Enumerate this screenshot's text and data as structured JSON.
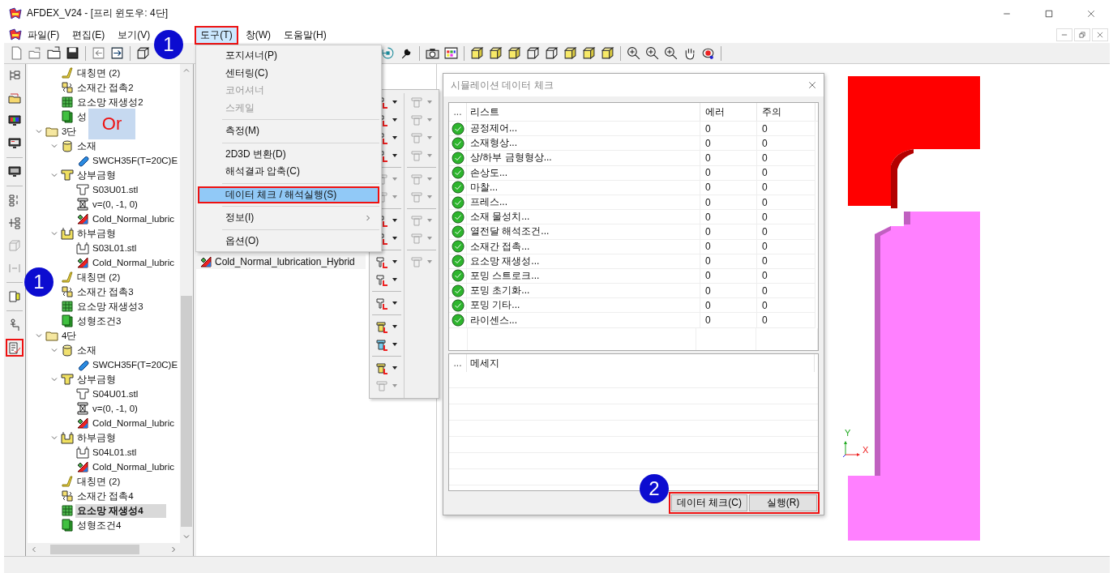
{
  "window": {
    "title": "AFDEX_V24 - [프리 윈도우: 4단]"
  },
  "menu_bar": [
    {
      "label": "파일(F)",
      "selected": false,
      "outlined": false
    },
    {
      "label": "편집(E)",
      "selected": false,
      "outlined": false
    },
    {
      "label": "보기(V)",
      "selected": false,
      "outlined": false
    },
    {
      "label": "도구(T)",
      "selected": true,
      "outlined": true
    },
    {
      "label": "창(W)",
      "selected": false,
      "outlined": false
    },
    {
      "label": "도움말(H)",
      "selected": false,
      "outlined": false
    }
  ],
  "left_toolbar": [
    {
      "outlined": false
    },
    {
      "outlined": false
    },
    {
      "outlined": false
    },
    {
      "outlined": false
    },
    {
      "outlined": false
    },
    {
      "outlined": false
    },
    {
      "outlined": false
    },
    {
      "outlined": false
    },
    {
      "outlined": false
    },
    {
      "outlined": false
    },
    {
      "outlined": false
    },
    {
      "outlined": true
    }
  ],
  "tree": {
    "continued_items": [
      {
        "label": "대칭면 (2)",
        "kind": "symmetry",
        "selected": false
      },
      {
        "label": "소재간 접촉2",
        "kind": "contact",
        "selected": false
      },
      {
        "label": "요소망 재생성2",
        "kind": "remesh",
        "selected": false
      },
      {
        "label": "성",
        "kind": "condition",
        "selected": false
      }
    ],
    "items": [
      {
        "label": "3단",
        "kind": "folder",
        "selected": false,
        "expanded": true,
        "children": [
          {
            "label": "소재",
            "kind": "material",
            "selected": false,
            "expanded": true,
            "children": [
              {
                "label": "SWCH35F(T=20C)E",
                "kind": "billet",
                "selected": false
              }
            ]
          },
          {
            "label": "상부금형",
            "kind": "upper-die",
            "selected": false,
            "expanded": true,
            "children": [
              {
                "label": "S03U01.stl",
                "kind": "die-file",
                "selected": false
              },
              {
                "label": "v=(0, -1, 0)",
                "kind": "velocity",
                "selected": false
              },
              {
                "label": "Cold_Normal_lubric",
                "kind": "lubricant",
                "selected": false
              }
            ]
          },
          {
            "label": "하부금형",
            "kind": "lower-die",
            "selected": false,
            "expanded": true,
            "children": [
              {
                "label": "S03L01.stl",
                "kind": "lower-file",
                "selected": false
              },
              {
                "label": "Cold_Normal_lubric",
                "kind": "lubricant",
                "selected": false
              }
            ]
          },
          {
            "label": "대칭면 (2)",
            "kind": "symmetry",
            "selected": false
          },
          {
            "label": "소재간 접촉3",
            "kind": "contact",
            "selected": false
          },
          {
            "label": "요소망 재생성3",
            "kind": "remesh",
            "selected": false
          },
          {
            "label": "성형조건3",
            "kind": "condition",
            "selected": false
          }
        ]
      },
      {
        "label": "4단",
        "kind": "folder",
        "selected": false,
        "expanded": true,
        "children": [
          {
            "label": "소재",
            "kind": "material",
            "selected": false,
            "expanded": true,
            "children": [
              {
                "label": "SWCH35F(T=20C)E",
                "kind": "billet",
                "selected": false
              }
            ]
          },
          {
            "label": "상부금형",
            "kind": "upper-die",
            "selected": false,
            "expanded": true,
            "children": [
              {
                "label": "S04U01.stl",
                "kind": "die-file",
                "selected": false
              },
              {
                "label": "v=(0, -1, 0)",
                "kind": "velocity",
                "selected": false
              },
              {
                "label": "Cold_Normal_lubric",
                "kind": "lubricant",
                "selected": false
              }
            ]
          },
          {
            "label": "하부금형",
            "kind": "lower-die",
            "selected": false,
            "expanded": true,
            "children": [
              {
                "label": "S04L01.stl",
                "kind": "lower-file",
                "selected": false
              },
              {
                "label": "Cold_Normal_lubric",
                "kind": "lubricant",
                "selected": false
              }
            ]
          },
          {
            "label": "대칭면 (2)",
            "kind": "symmetry",
            "selected": false
          },
          {
            "label": "소재간 접촉4",
            "kind": "contact",
            "selected": false
          },
          {
            "label": "요소망 재생성4",
            "kind": "remesh",
            "selected": true
          },
          {
            "label": "성형조건4",
            "kind": "condition",
            "selected": false
          }
        ]
      }
    ]
  },
  "side_panel": {
    "items": [
      {
        "label": "Cold_Normal_lubrication_Hybrid",
        "kind": "lubricant"
      }
    ]
  },
  "tools_menu": {
    "entries": [
      {
        "kind": "item",
        "label": "포지셔너(P)",
        "disabled": false,
        "selected": false,
        "outlined": false,
        "submenu": false
      },
      {
        "kind": "item",
        "label": "센터링(C)",
        "disabled": false,
        "selected": false,
        "outlined": false,
        "submenu": false
      },
      {
        "kind": "item",
        "label": "코어셔너",
        "disabled": true,
        "selected": false,
        "outlined": false,
        "submenu": false
      },
      {
        "kind": "item",
        "label": "스케일",
        "disabled": true,
        "selected": false,
        "outlined": false,
        "submenu": false
      },
      {
        "kind": "separator"
      },
      {
        "kind": "item",
        "label": "측정(M)",
        "disabled": false,
        "selected": false,
        "outlined": false,
        "submenu": false
      },
      {
        "kind": "separator"
      },
      {
        "kind": "item",
        "label": "2D3D 변환(D)",
        "disabled": false,
        "selected": false,
        "outlined": false,
        "submenu": false
      },
      {
        "kind": "item",
        "label": "해석결과 압축(C)",
        "disabled": false,
        "selected": false,
        "outlined": false,
        "submenu": false
      },
      {
        "kind": "separator"
      },
      {
        "kind": "item",
        "label": "데이터 체크 / 해석실행(S)",
        "disabled": false,
        "selected": true,
        "outlined": true,
        "submenu": false
      },
      {
        "kind": "separator"
      },
      {
        "kind": "item",
        "label": "정보(I)",
        "disabled": false,
        "selected": false,
        "outlined": false,
        "submenu": true
      },
      {
        "kind": "separator"
      },
      {
        "kind": "item",
        "label": "옵션(O)",
        "disabled": false,
        "selected": false,
        "outlined": false,
        "submenu": false
      }
    ]
  },
  "dialog": {
    "title": "시뮬레이션 데이터 체크",
    "table": {
      "columns": [
        "...",
        "리스트",
        "에러",
        "주의"
      ],
      "rows": [
        {
          "kind": "ok",
          "name": "공정제어...",
          "errors": "0",
          "warnings": "0"
        },
        {
          "kind": "ok",
          "name": "소재형상...",
          "errors": "0",
          "warnings": "0"
        },
        {
          "kind": "ok",
          "name": "상/하부 금형형상...",
          "errors": "0",
          "warnings": "0"
        },
        {
          "kind": "ok",
          "name": "손상도...",
          "errors": "0",
          "warnings": "0"
        },
        {
          "kind": "ok",
          "name": "마찰...",
          "errors": "0",
          "warnings": "0"
        },
        {
          "kind": "ok",
          "name": "프레스...",
          "errors": "0",
          "warnings": "0"
        },
        {
          "kind": "ok",
          "name": "소재 물성치...",
          "errors": "0",
          "warnings": "0"
        },
        {
          "kind": "ok",
          "name": "열전달 해석조건...",
          "errors": "0",
          "warnings": "0"
        },
        {
          "kind": "ok",
          "name": "소재간 접촉...",
          "errors": "0",
          "warnings": "0"
        },
        {
          "kind": "ok",
          "name": "요소망 재생성...",
          "errors": "0",
          "warnings": "0"
        },
        {
          "kind": "ok",
          "name": "포밍 스트로크...",
          "errors": "0",
          "warnings": "0"
        },
        {
          "kind": "ok",
          "name": "포밍 초기화...",
          "errors": "0",
          "warnings": "0"
        },
        {
          "kind": "ok",
          "name": "포밍 기타...",
          "errors": "0",
          "warnings": "0"
        },
        {
          "kind": "ok",
          "name": "라이센스...",
          "errors": "0",
          "warnings": "0"
        }
      ]
    },
    "messages": {
      "columns": [
        "...",
        "메세지"
      ]
    },
    "buttons": [
      {
        "label": "데이터 체크(C)"
      },
      {
        "label": "실행(R)"
      }
    ],
    "buttons_outlined": true
  },
  "viewport": {
    "axis_labels": {
      "x": "X",
      "y": "Y"
    }
  },
  "callouts": {
    "badges": [
      {
        "kind": "menu",
        "label": "1"
      },
      {
        "kind": "toolbar",
        "label": "1"
      },
      {
        "kind": "buttons",
        "label": "2"
      }
    ],
    "note": "Or"
  }
}
